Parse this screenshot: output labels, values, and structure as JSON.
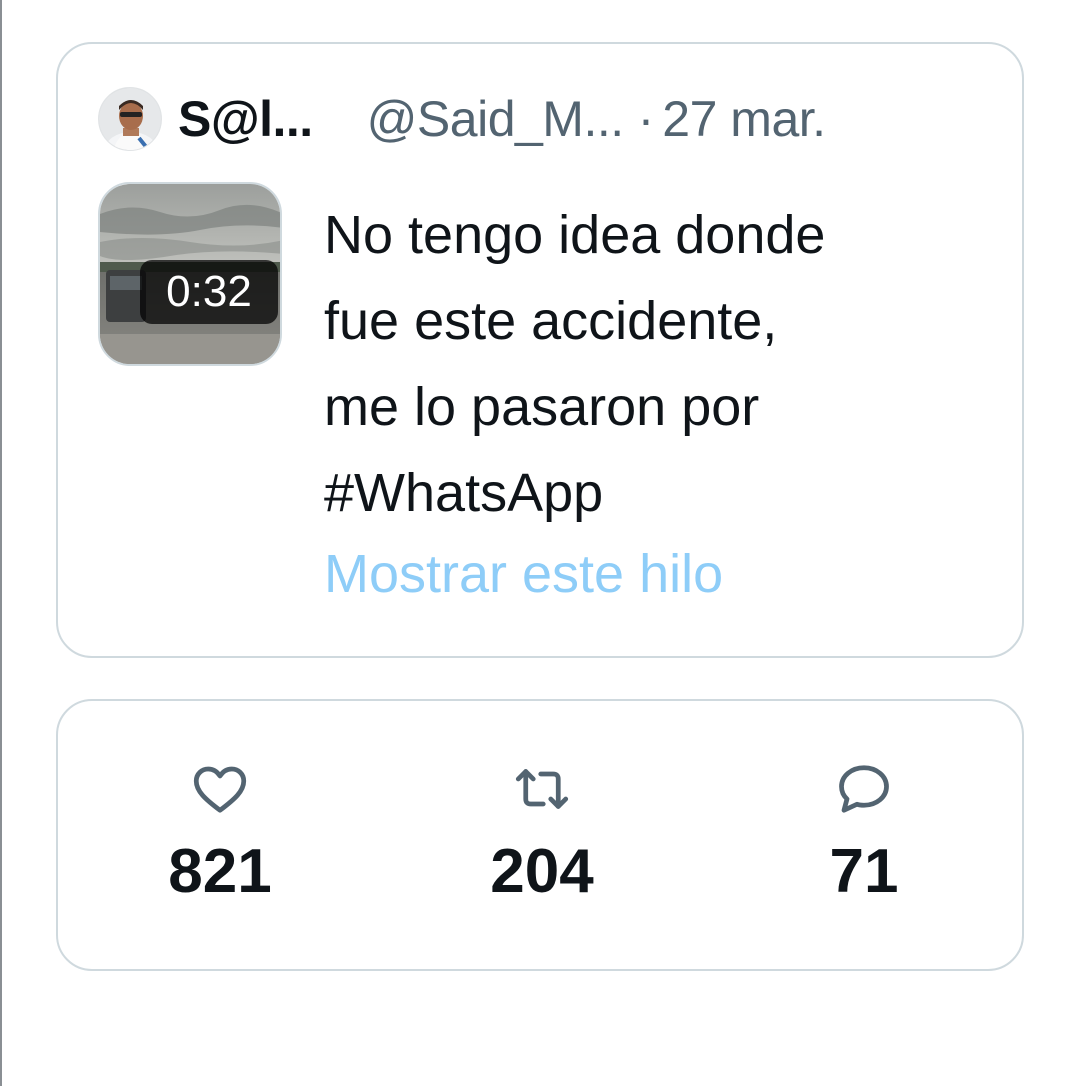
{
  "tweet": {
    "display_name": "S@l...",
    "handle": "@Said_M...",
    "separator": "·",
    "date": "27 mar.",
    "media": {
      "type": "video",
      "duration": "0:32"
    },
    "text_lines": [
      "No tengo idea donde",
      "fue este accidente,",
      "me lo pasaron por",
      "#WhatsApp"
    ],
    "show_thread_label": "Mostrar este hilo"
  },
  "stats": {
    "likes": {
      "icon": "heart-icon",
      "count": "821"
    },
    "retweets": {
      "icon": "retweet-icon",
      "count": "204"
    },
    "replies": {
      "icon": "reply-icon",
      "count": "71"
    }
  },
  "colors": {
    "text_primary": "#0f1419",
    "text_secondary": "#536471",
    "link_faded": "#8ecdf8",
    "card_border": "#cfd9de"
  }
}
